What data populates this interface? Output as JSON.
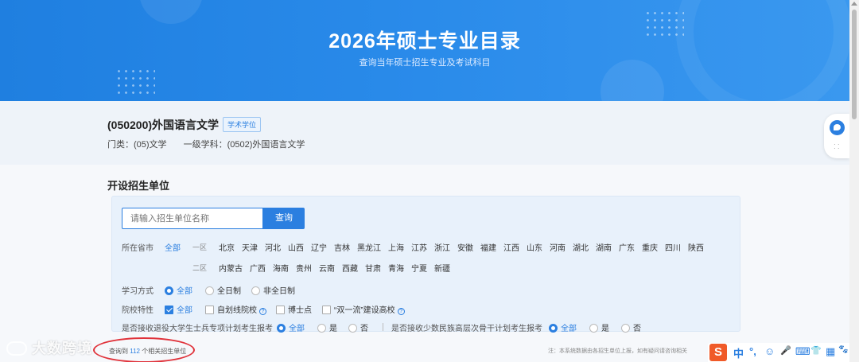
{
  "banner": {
    "title": "2026年硕士专业目录",
    "subtitle": "查询当年硕士招生专业及考试科目"
  },
  "major": {
    "title": "(050200)外国语言文学",
    "badge": "学术学位",
    "category": "门类：(05)文学",
    "discipline": "一级学科：(0502)外国语言文学"
  },
  "section_title": "开设招生单位",
  "search": {
    "placeholder": "请输入招生单位名称",
    "button": "查询"
  },
  "filters": {
    "province_label": "所在省市",
    "all_label": "全部",
    "zone1_label": "一区",
    "zone2_label": "二区",
    "zone1": [
      "北京",
      "天津",
      "河北",
      "山西",
      "辽宁",
      "吉林",
      "黑龙江",
      "上海",
      "江苏",
      "浙江",
      "安徽",
      "福建",
      "江西",
      "山东",
      "河南",
      "湖北",
      "湖南",
      "广东",
      "重庆",
      "四川",
      "陕西"
    ],
    "zone2": [
      "内蒙古",
      "广西",
      "海南",
      "贵州",
      "云南",
      "西藏",
      "甘肃",
      "青海",
      "宁夏",
      "新疆"
    ],
    "study_mode_label": "学习方式",
    "study_mode_options": [
      "全部",
      "全日制",
      "非全日制"
    ],
    "school_label": "院校特性",
    "school_options": [
      "全部",
      "自划线院校",
      "博士点",
      "“双一流”建设高校"
    ],
    "veteran_label": "是否接收退役大学生士兵专项计划考生报考",
    "veteran_options": [
      "全部",
      "是",
      "否"
    ],
    "minority_label": "是否接收少数民族高层次骨干计划考生报考",
    "minority_options": [
      "全部",
      "是",
      "否"
    ]
  },
  "result": {
    "prefix": "查询到",
    "count": "112",
    "suffix": "个相关招生单位"
  },
  "note": "注：本系统数据由各招生单位上报，如有疑问请咨询相关",
  "watermark": "大数跨境",
  "ime": {
    "logo": "S",
    "items": [
      "中",
      "°,",
      "☺",
      "🎤",
      "⌨",
      "👕",
      "▦",
      "🐾"
    ]
  },
  "colors": {
    "accent": "#2b7fe0",
    "banner": "#2a8bea",
    "highlight_ring": "#e0323a"
  }
}
